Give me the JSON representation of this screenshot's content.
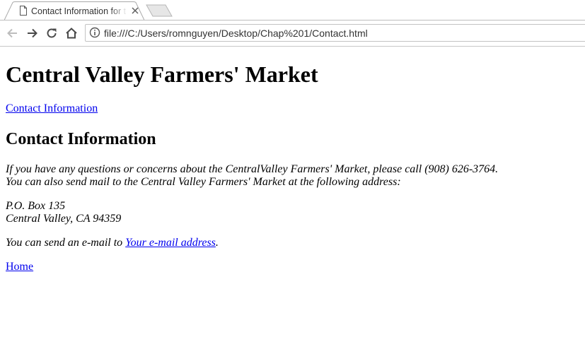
{
  "browser": {
    "tab_title": "Contact Information for the Central Valley Farmers' Market",
    "url": "file:///C:/Users/romnguyen/Desktop/Chap%201/Contact.html"
  },
  "page": {
    "heading": "Central Valley Farmers' Market",
    "nav_link": "Contact Information",
    "section_heading": "Contact Information",
    "intro_line1": "If you have any questions or concerns about the CentralValley Farmers' Market, please call (908) 626-3764.",
    "intro_line2": "You can also send mail to the Central Valley Farmers' Market at the following address:",
    "address_line1": "P.O. Box 135",
    "address_line2": "Central Valley, CA 94359",
    "email_prefix": "You can send an e-mail to ",
    "email_link": "Your e-mail address",
    "email_suffix": ".",
    "home_link": "Home"
  },
  "colors": {
    "link": "#0000ee",
    "tabstrip_border": "#bdbdbd",
    "toolbar_icon": "#5a5a5a"
  },
  "icons": [
    "document-icon",
    "close-icon",
    "back-arrow-icon",
    "forward-arrow-icon",
    "reload-icon",
    "home-icon",
    "info-icon"
  ]
}
